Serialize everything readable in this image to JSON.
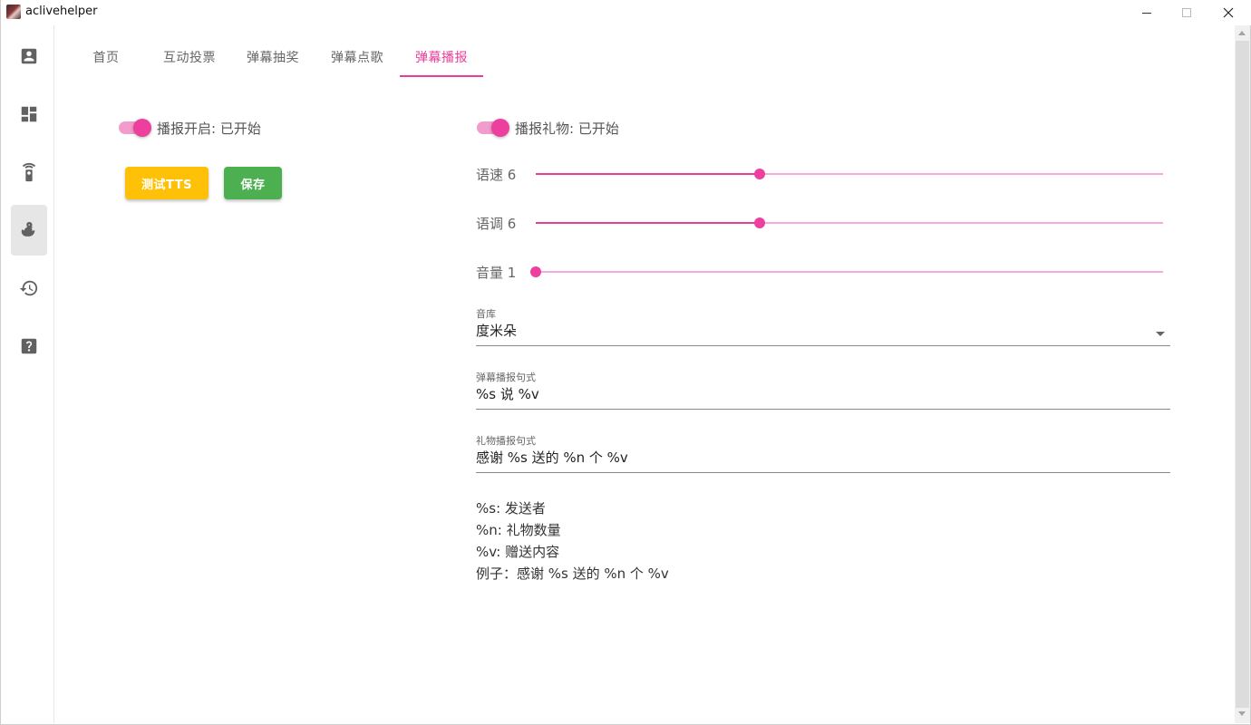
{
  "window": {
    "title": "aclivehelper"
  },
  "sidebar": {
    "items": [
      {
        "name": "account-box-icon"
      },
      {
        "name": "dashboard-icon"
      },
      {
        "name": "remote-icon"
      },
      {
        "name": "duck-icon",
        "active": true
      },
      {
        "name": "history-icon"
      },
      {
        "name": "help-icon"
      }
    ]
  },
  "tabs": [
    {
      "label": "首页"
    },
    {
      "label": "互动投票"
    },
    {
      "label": "弹幕抽奖"
    },
    {
      "label": "弹幕点歌"
    },
    {
      "label": "弹幕播报",
      "active": true
    }
  ],
  "left": {
    "toggle_label": "播报开启: 已开始",
    "toggle_on": true,
    "test_button": "测试TTS",
    "save_button": "保存"
  },
  "right": {
    "gift_toggle_label": "播报礼物: 已开始",
    "gift_toggle_on": true,
    "sliders": [
      {
        "label": "语速 6",
        "value": 6,
        "min": 1,
        "max": 15
      },
      {
        "label": "语调 6",
        "value": 6,
        "min": 1,
        "max": 15
      },
      {
        "label": "音量 1",
        "value": 1,
        "min": 1,
        "max": 15
      }
    ],
    "voice": {
      "label": "音库",
      "value": "度米朵"
    },
    "danmaku_format": {
      "label": "弹幕播报句式",
      "value": "%s 说 %v"
    },
    "gift_format": {
      "label": "礼物播报句式",
      "value": "感谢 %s 送的 %n 个 %v"
    },
    "help_lines": [
      "%s: 发送者",
      "%n: 礼物数量",
      "%v: 赠送内容",
      "例子：感谢 %s 送的 %n 个 %v"
    ]
  },
  "colors": {
    "accent": "#e83e9a",
    "accent_light": "#f5a9dc",
    "warning": "#ffc107",
    "success": "#4caf50"
  }
}
